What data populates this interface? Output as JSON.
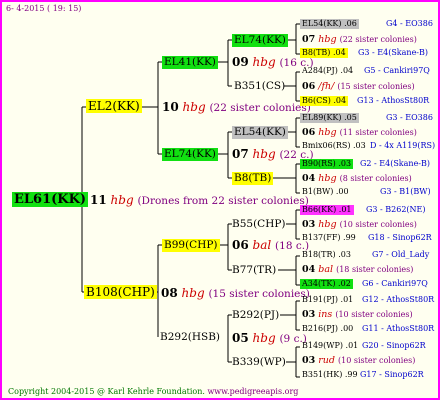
{
  "header": {
    "date": "6-  4-2015 ( 19: 15)"
  },
  "footer": {
    "copyright": "Copyright 2004-2015 @ Karl Kehrle Foundation.",
    "website": "www.pedigreeapis.org"
  },
  "root": {
    "label": "EL61(KK)",
    "num": "11",
    "hbg": "hbg",
    "note": "(Drones from 22 sister colonies)"
  },
  "n1": {
    "label": "EL2(KK)",
    "num": "10",
    "hbg": "hbg",
    "note": "(22 sister colonies)"
  },
  "n2": {
    "label": "B108(CHP)",
    "num": "08",
    "hbg": "hbg",
    "note": "(15 sister colonies)"
  },
  "n11": {
    "label": "EL41(KK)",
    "num": "09",
    "hbg": "hbg",
    "note": "(16 c.)"
  },
  "n12": {
    "label": "EL74(KK)",
    "num": "07",
    "hbg": "hbg",
    "note": "(22 c.)"
  },
  "n21": {
    "label": "B99(CHP)",
    "num": "06",
    "hbg": "bal",
    "note": "(18 c.)"
  },
  "n22": {
    "label": "B292(HSB)",
    "num": "05",
    "hbg": "hbg",
    "note": "(9 c.)"
  },
  "n111": {
    "label": "EL74(KK)"
  },
  "n112": {
    "label": "B351(CS)"
  },
  "n121": {
    "label": "EL54(KK)"
  },
  "n122": {
    "label": "B8(TB)"
  },
  "n211": {
    "label": "B55(CHP)"
  },
  "n212": {
    "label": "B77(TR)"
  },
  "n221": {
    "label": "B292(PJ)"
  },
  "n222": {
    "label": "B339(WP)"
  },
  "right": [
    {
      "top": "EL54(KK) .06",
      "topcode": "G4 - EO386",
      "num": "07",
      "hbg": "hbg",
      "note": "(22 sister colonies)",
      "bot": "B8(TB) .04",
      "botcode": "G3 - E4(Skane-B)"
    },
    {
      "top": "A284(PJ) .04",
      "topcode": "G5 - Cankiri97Q",
      "num": "06",
      "hbg": "/fh/",
      "note": "(15 sister colonies)",
      "bot": "B6(CS) .04",
      "botcode": "G13 - AthosSt80R"
    },
    {
      "top": "EL89(KK) .05",
      "topcode": "G3 - EO386",
      "num": "06",
      "hbg": "hbg",
      "note": "(11 sister colonies)",
      "bot": "Bmix06(RS) .03",
      "botcode": "D - 4x A119(RS)"
    },
    {
      "top": "B90(RS) .03",
      "topcode": "G2 - E4(Skane-B)",
      "num": "04",
      "hbg": "hbg",
      "note": "(8 sister colonies)",
      "bot": "B1(BW) .00",
      "botcode": "G3 - B1(BW)"
    },
    {
      "top": "B66(KK) .01",
      "topcode": "G3 - B262(NE)",
      "num": "03",
      "hbg": "hbg",
      "note": "(10 sister colonies)",
      "bot": "B137(FF) .99",
      "botcode": "G18 - Sinop62R"
    },
    {
      "top": "B18(TR) .03",
      "topcode": "G7 - Old_Lady",
      "num": "04",
      "hbg": "bal",
      "note": "(18 sister colonies)",
      "bot": "A34(TK) .02",
      "botcode": "G6 - Cankiri97Q"
    },
    {
      "top": "B191(PJ) .01",
      "topcode": "G12 - AthosSt80R",
      "num": "03",
      "hbg": "ins",
      "note": "(10 sister colonies)",
      "bot": "B216(PJ) .00",
      "botcode": "G11 - AthosSt80R"
    },
    {
      "top": "B149(WP) .01",
      "topcode": "G20 - Sinop62R",
      "num": "03",
      "hbg": "rud",
      "note": "(10 sister colonies)",
      "bot": "B351(HK) .99",
      "botcode": "G17 - Sinop62R"
    }
  ]
}
